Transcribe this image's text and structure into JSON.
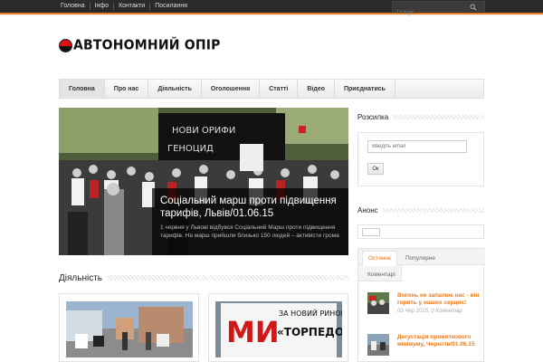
{
  "topnav": {
    "items": [
      "Головна",
      "Інфо",
      "Контакти",
      "Посилання"
    ],
    "search_placeholder": "Пошук..."
  },
  "logo": {
    "text": "АВТОНОМНИЙ ОПІР"
  },
  "mainnav": {
    "items": [
      "Головна",
      "Про нас",
      "Діяльність",
      "Оголошення",
      "Статті",
      "Відео",
      "Приєднатись"
    ],
    "active": "Головна"
  },
  "slider": {
    "title": "Соціальний марш проти підвищення тарифів, Львів/01.06.15",
    "excerpt": "1 червня у Львові відбувся Соціальний Марш проти підвищення тарифів. На марш прийшли близько 150 людей – активісти грома"
  },
  "activity": {
    "heading": "Діяльність",
    "card2_banner_line1": "МИ",
    "card2_banner_line2": "ЗА НОВИЙ РИНОК",
    "card2_banner_line3": "«ТОРПЕДО»"
  },
  "sidebar": {
    "subscribe_heading": "Розсилка",
    "email_placeholder": "Введіть email",
    "ok_label": "Ок",
    "anons_heading": "Анонс",
    "tabs": [
      "Останнє",
      "Популярне",
      "Коментарі"
    ],
    "active_tab": "Останнє",
    "posts": [
      {
        "title": "Вогонь не запалює нас - він горить у наших серцях!",
        "meta": "03 Чер 2015, 0 Коментар"
      },
      {
        "title": "Дегустація прожиткового мінімуму, Чернігів/01.06.15",
        "meta": ""
      }
    ]
  },
  "colors": {
    "accent": "#e67e22",
    "topbar": "#2b2b2b"
  }
}
